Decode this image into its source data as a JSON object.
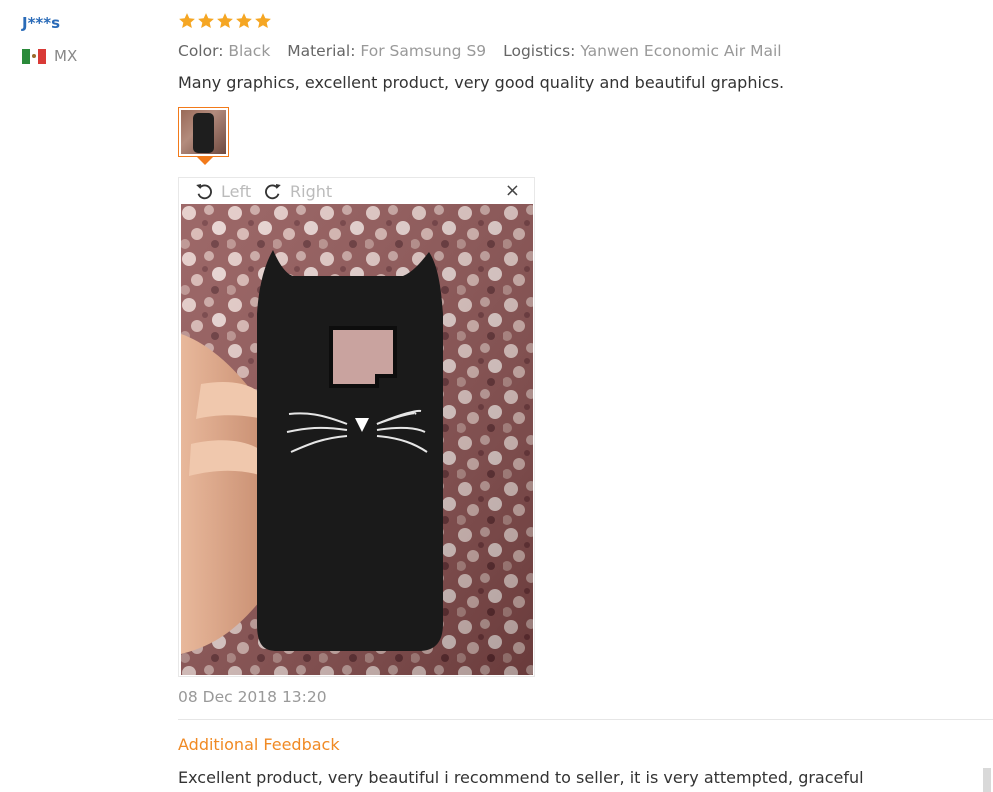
{
  "reviewer": {
    "name": "J***s",
    "country_code": "MX",
    "flag_icon": "mexico-flag-icon"
  },
  "review": {
    "rating": 5,
    "rating_max": 5,
    "star_color": "#f5a623",
    "attributes": [
      {
        "key": "Color:",
        "value": "Black"
      },
      {
        "key": "Material:",
        "value": "For Samsung S9"
      },
      {
        "key": "Logistics:",
        "value": "Yanwen Economic Air Mail"
      }
    ],
    "text": "Many graphics, excellent product, very good quality and beautiful graphics.",
    "date": "08 Dec 2018 13:20"
  },
  "image_viewer": {
    "rotate_left_label": "Left",
    "rotate_right_label": "Right",
    "close_label": "×",
    "thumbnail_selected": true
  },
  "additional_feedback": {
    "label": "Additional Feedback",
    "text": "Excellent product, very beautiful i recommend to seller, it is very attempted, graceful"
  },
  "colors": {
    "accent_orange": "#f27a1a",
    "link_blue": "#2a6bb8"
  }
}
